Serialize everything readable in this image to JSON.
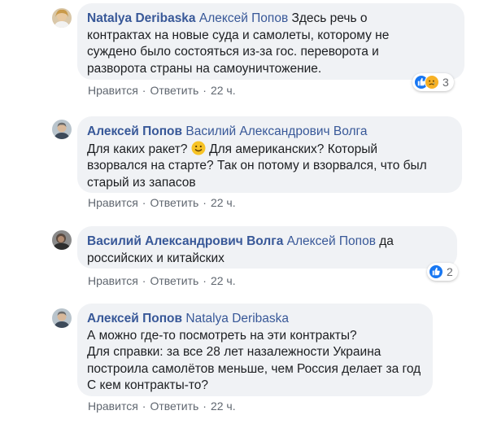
{
  "comments": [
    {
      "author": "Natalya Deribaska",
      "mention": "Алексей Попов",
      "lines": [
        " Здесь речь о",
        "контрактах на новые суда и самолеты, которому не",
        "суждено было состояться из-за гос. переворота и",
        "разворота страны на самоуничтожение."
      ],
      "like": "Нравится",
      "reply": "Ответить",
      "time": "22 ч.",
      "reaction_count": "3"
    },
    {
      "author": "Алексей Попов",
      "mention": "Василий Александрович Волга",
      "line1_a": "Для каких ракет?",
      "line1_b": "Для американских? Который",
      "lines": [
        "взорвался на старте? Так он потому и взорвался, что был",
        "старый из запасов"
      ],
      "like": "Нравится",
      "reply": "Ответить",
      "time": "22 ч."
    },
    {
      "author": "Василий Александрович Волга",
      "mention": "Алексей Попов",
      "tail": " да",
      "lines": [
        "российских и китайских"
      ],
      "like": "Нравится",
      "reply": "Ответить",
      "time": "22 ч.",
      "reaction_count": "2"
    },
    {
      "author": "Алексей Попов",
      "mention": "Natalya Deribaska",
      "lines": [
        "А можно где-то посмотреть на эти контракты?",
        "Для справки: за все 28 лет назалежности Украина",
        "построила самолётов меньше, чем Россия делает за год",
        "С кем контракты-то?"
      ],
      "like": "Нравится",
      "reply": "Ответить",
      "time": "22 ч."
    }
  ],
  "colors": {
    "name": "#385898",
    "bubble": "#f0f2f5",
    "meta": "#606770",
    "like": "#1877f2",
    "sad": "#f7b125"
  }
}
